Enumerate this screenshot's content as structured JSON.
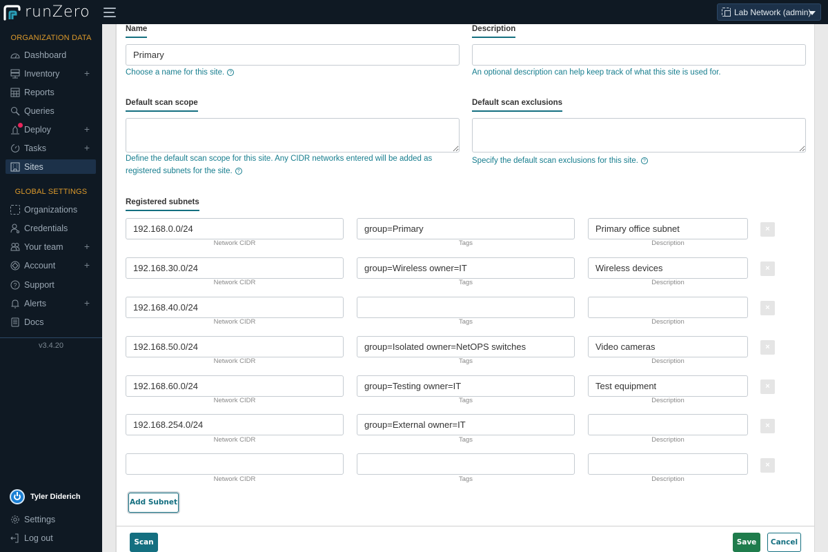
{
  "app": {
    "brand": "runZero",
    "org_selector": "Lab Network (admin)"
  },
  "sidebar": {
    "org_section_title": "ORGANIZATION DATA",
    "org_items": [
      {
        "label": "Dashboard",
        "icon": "dashboard-icon",
        "expandable": false
      },
      {
        "label": "Inventory",
        "icon": "inventory-icon",
        "expandable": true
      },
      {
        "label": "Reports",
        "icon": "reports-icon",
        "expandable": false
      },
      {
        "label": "Queries",
        "icon": "queries-icon",
        "expandable": false
      },
      {
        "label": "Deploy",
        "icon": "deploy-icon",
        "expandable": true,
        "notification": true
      },
      {
        "label": "Tasks",
        "icon": "tasks-icon",
        "expandable": true
      },
      {
        "label": "Sites",
        "icon": "sites-icon",
        "expandable": false,
        "active": true
      }
    ],
    "global_section_title": "GLOBAL SETTINGS",
    "global_items": [
      {
        "label": "Organizations",
        "icon": "organizations-icon",
        "expandable": false
      },
      {
        "label": "Credentials",
        "icon": "credentials-icon",
        "expandable": false
      },
      {
        "label": "Your team",
        "icon": "team-icon",
        "expandable": true
      },
      {
        "label": "Account",
        "icon": "account-icon",
        "expandable": true
      },
      {
        "label": "Support",
        "icon": "support-icon",
        "expandable": false
      },
      {
        "label": "Alerts",
        "icon": "alerts-icon",
        "expandable": true
      },
      {
        "label": "Docs",
        "icon": "docs-icon",
        "expandable": false
      }
    ],
    "version": "v3.4.20",
    "user_name": "Tyler Diderich",
    "settings_label": "Settings",
    "logout_label": "Log out"
  },
  "form": {
    "name": {
      "label": "Name",
      "value": "Primary",
      "help": "Choose a name for this site."
    },
    "description": {
      "label": "Description",
      "value": "",
      "help": "An optional description can help keep track of what this site is used for."
    },
    "scope": {
      "label": "Default scan scope",
      "value": "",
      "help": "Define the default scan scope for this site. Any CIDR networks entered will be added as registered subnets for the site."
    },
    "exclusions": {
      "label": "Default scan exclusions",
      "value": "",
      "help": "Specify the default scan exclusions for this site."
    },
    "subnets": {
      "label": "Registered subnets",
      "captions": {
        "cidr": "Network CIDR",
        "tags": "Tags",
        "description": "Description"
      },
      "remove_glyph": "×",
      "rows": [
        {
          "cidr": "192.168.0.0/24",
          "tags": "group=Primary",
          "description": "Primary office subnet"
        },
        {
          "cidr": "192.168.30.0/24",
          "tags": "group=Wireless owner=IT",
          "description": "Wireless devices"
        },
        {
          "cidr": "192.168.40.0/24",
          "tags": "",
          "description": ""
        },
        {
          "cidr": "192.168.50.0/24",
          "tags": "group=Isolated owner=NetOPS switches",
          "description": "Video cameras"
        },
        {
          "cidr": "192.168.60.0/24",
          "tags": "group=Testing owner=IT",
          "description": "Test equipment"
        },
        {
          "cidr": "192.168.254.0/24",
          "tags": "group=External owner=IT",
          "description": ""
        },
        {
          "cidr": "",
          "tags": "",
          "description": ""
        }
      ]
    },
    "add_subnet_label": "Add Subnet"
  },
  "footer": {
    "scan_label": "Scan",
    "save_label": "Save",
    "cancel_label": "Cancel"
  },
  "colors": {
    "nav_bg": "#0f1923",
    "accent_teal": "#146f80",
    "save_green": "#1f7c4c",
    "section_title": "#dd9a2b"
  }
}
